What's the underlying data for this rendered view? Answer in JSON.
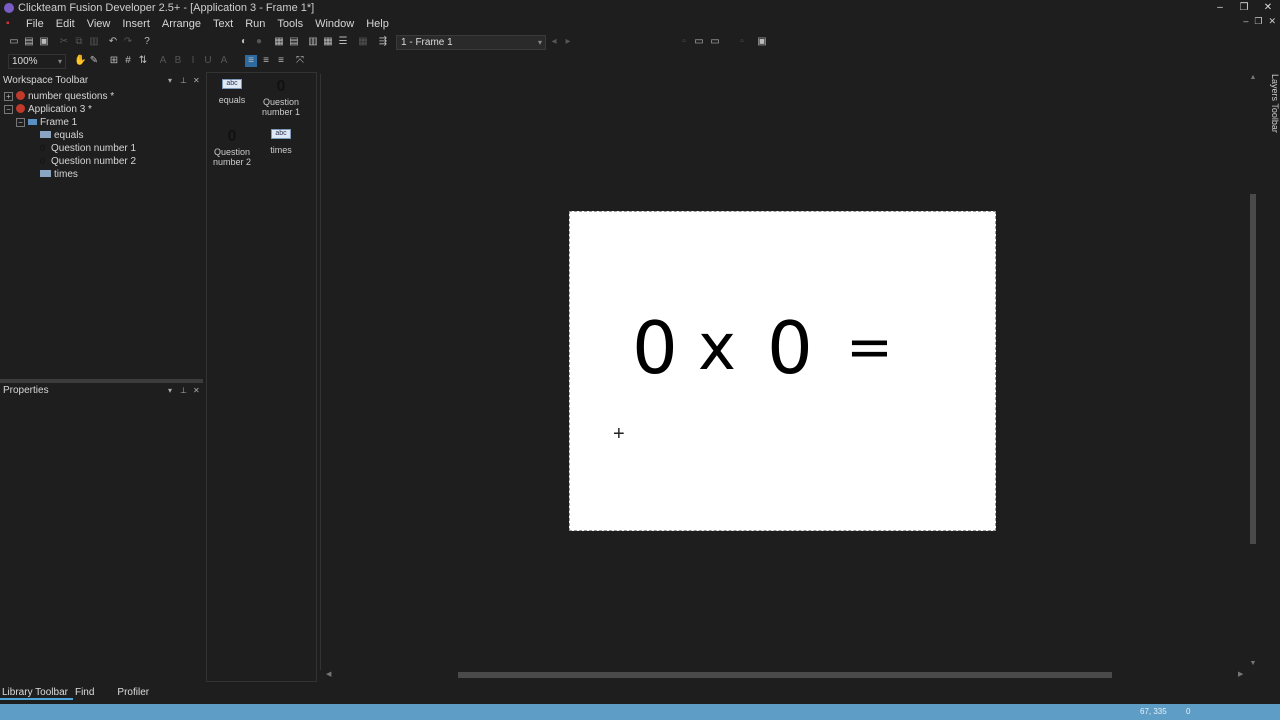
{
  "window": {
    "title": "Clickteam Fusion Developer 2.5+ - [Application 3 - Frame 1*]"
  },
  "menu": {
    "items": [
      "File",
      "Edit",
      "View",
      "Insert",
      "Arrange",
      "Text",
      "Run",
      "Tools",
      "Window",
      "Help"
    ]
  },
  "toolbar": {
    "frame_select": "1 - Frame 1",
    "zoom": "100%"
  },
  "workspace": {
    "title": "Workspace Toolbar",
    "tree": [
      {
        "label": "number questions *",
        "level": 0
      },
      {
        "label": "Application 3 *",
        "level": 0
      },
      {
        "label": "Frame 1",
        "level": 1
      },
      {
        "label": "equals",
        "level": 2
      },
      {
        "label": "Question number 1",
        "level": 2
      },
      {
        "label": "Question number 2",
        "level": 2
      },
      {
        "label": "times",
        "level": 2
      }
    ]
  },
  "properties": {
    "title": "Properties"
  },
  "objects": [
    {
      "label": "equals",
      "icon": "abc-text-object-icon"
    },
    {
      "label": "Question number 1",
      "icon": "counter-object-icon"
    },
    {
      "label": "Question number 2",
      "icon": "counter-object-icon"
    },
    {
      "label": "times",
      "icon": "abc-text-object-icon"
    }
  ],
  "frame": {
    "q1": "0",
    "times": "x",
    "q2": "0",
    "equals": "="
  },
  "layers": {
    "label": "Layers Toolbar"
  },
  "bottom_tabs": {
    "library": "Library Toolbar",
    "find": "Find",
    "profiler": "Profiler"
  },
  "status": {
    "coords": "67, 335",
    "value": "0"
  },
  "colors": {
    "background": "#1e1e1e",
    "statusbar": "#5e9ec6",
    "accent": "#4ea3d9"
  }
}
